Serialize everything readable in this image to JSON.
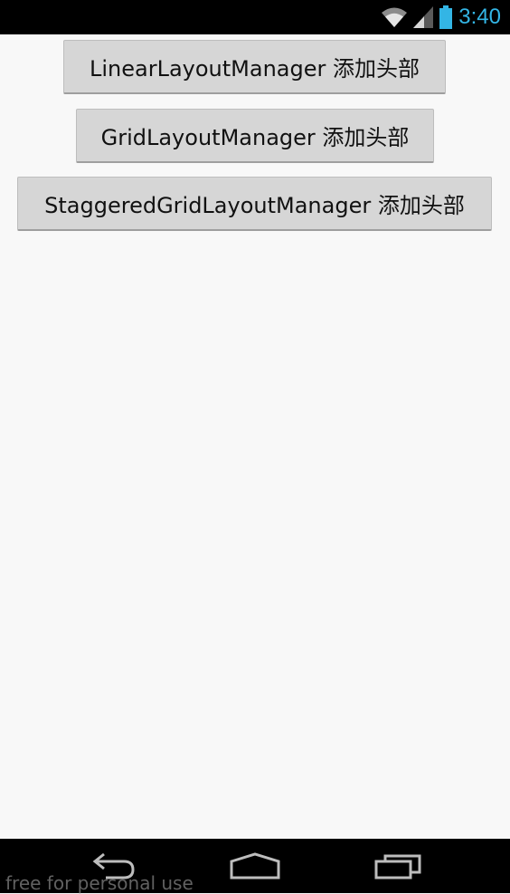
{
  "status_bar": {
    "time": "3:40",
    "wifi_icon": "wifi-icon",
    "signal_icon": "signal-icon",
    "battery_icon": "battery-icon",
    "accent_color": "#33b5e5"
  },
  "main": {
    "buttons": [
      {
        "label": "LinearLayoutManager 添加头部"
      },
      {
        "label": "GridLayoutManager 添加头部"
      },
      {
        "label": "StaggeredGridLayoutManager 添加头部"
      }
    ]
  },
  "nav_bar": {
    "back_icon": "back-icon",
    "home_icon": "home-icon",
    "recents_icon": "recents-icon",
    "watermark": "free for personal use"
  }
}
